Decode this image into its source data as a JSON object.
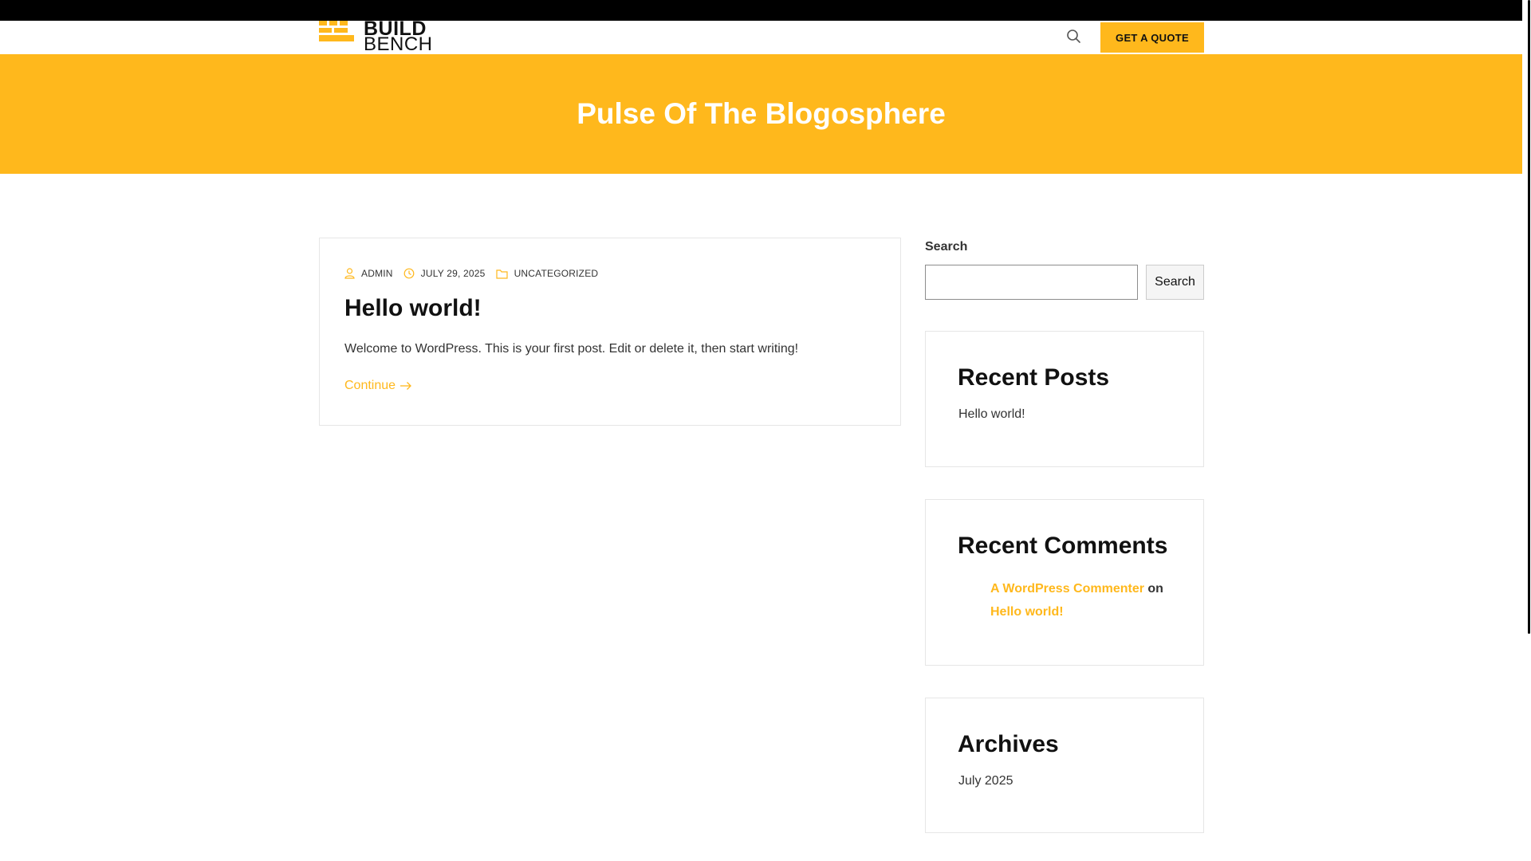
{
  "header": {
    "logo": {
      "line1": "BUILD",
      "line2": "BENCH"
    },
    "quote_button": "GET A QUOTE",
    "search_icon": "search-icon"
  },
  "hero": {
    "title": "Pulse Of The Blogosphere"
  },
  "post": {
    "author": "ADMIN",
    "date": "JULY 29, 2025",
    "category": "UNCATEGORIZED",
    "title": "Hello world!",
    "excerpt": "Welcome to WordPress. This is your first post. Edit or delete it, then start writing!",
    "continue_label": "Continue"
  },
  "sidebar": {
    "search_label": "Search",
    "search_button": "Search",
    "recent_posts": {
      "title": "Recent Posts",
      "items": [
        "Hello world!"
      ]
    },
    "recent_comments": {
      "title": "Recent Comments",
      "author": "A WordPress Commenter",
      "on_text": "on",
      "post": "Hello world!"
    },
    "archives": {
      "title": "Archives",
      "items": [
        "July 2025"
      ]
    }
  },
  "colors": {
    "accent": "#FFB81C",
    "text": "#333333",
    "heading": "#111111",
    "topbar": "#000000"
  }
}
